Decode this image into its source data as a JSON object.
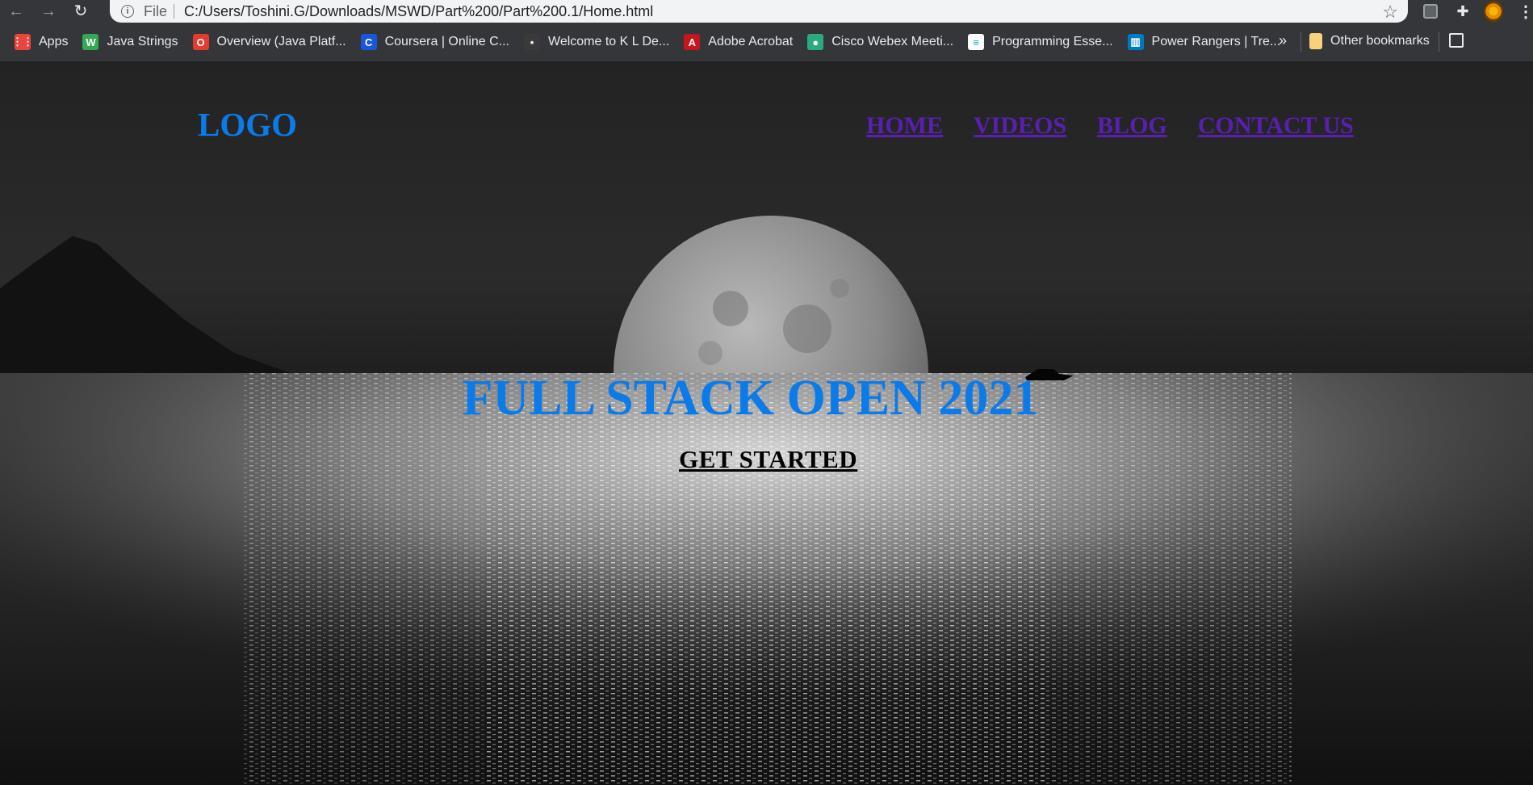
{
  "browser": {
    "back_icon": "arrow-left-icon",
    "forward_icon": "arrow-right-icon",
    "reload_icon": "reload-icon",
    "scheme_label": "File",
    "url": "C:/Users/Toshini.G/Downloads/MSWD/Part%200/Part%200.1/Home.html",
    "bookmarks": [
      {
        "label": "Apps",
        "icon": "apps-grid-icon",
        "color": "#e8453c"
      },
      {
        "label": "Java Strings",
        "icon": "w-logo-icon",
        "color": "#34a853"
      },
      {
        "label": "Overview (Java Platf...",
        "icon": "oracle-icon",
        "color": "#e33b2e"
      },
      {
        "label": "Coursera | Online C...",
        "icon": "coursera-icon",
        "color": "#1a56db"
      },
      {
        "label": "Welcome to K L De...",
        "icon": "kl-icon",
        "color": "#3a3a3a"
      },
      {
        "label": "Adobe Acrobat",
        "icon": "acrobat-icon",
        "color": "#c4161c"
      },
      {
        "label": "Cisco Webex Meeti...",
        "icon": "webex-icon",
        "color": "#2bab7d"
      },
      {
        "label": "Programming Esse...",
        "icon": "cisco-icon",
        "color": "#ffffff"
      },
      {
        "label": "Power Rangers | Tre...",
        "icon": "trello-icon",
        "color": "#0079bf"
      }
    ],
    "more_label": "»",
    "other_bookmarks": "Other bookmarks"
  },
  "page": {
    "logo": "LOGO",
    "nav": [
      "HOME",
      "VIDEOS",
      "BLOG",
      "CONTACT US"
    ],
    "hero_title": "FULL STACK OPEN 2021",
    "cta": "GET STARTED"
  },
  "colors": {
    "logo": "#0a7be8",
    "nav_link": "#5a1fb0",
    "hero_title": "#0a7be8",
    "cta": "#000000"
  }
}
